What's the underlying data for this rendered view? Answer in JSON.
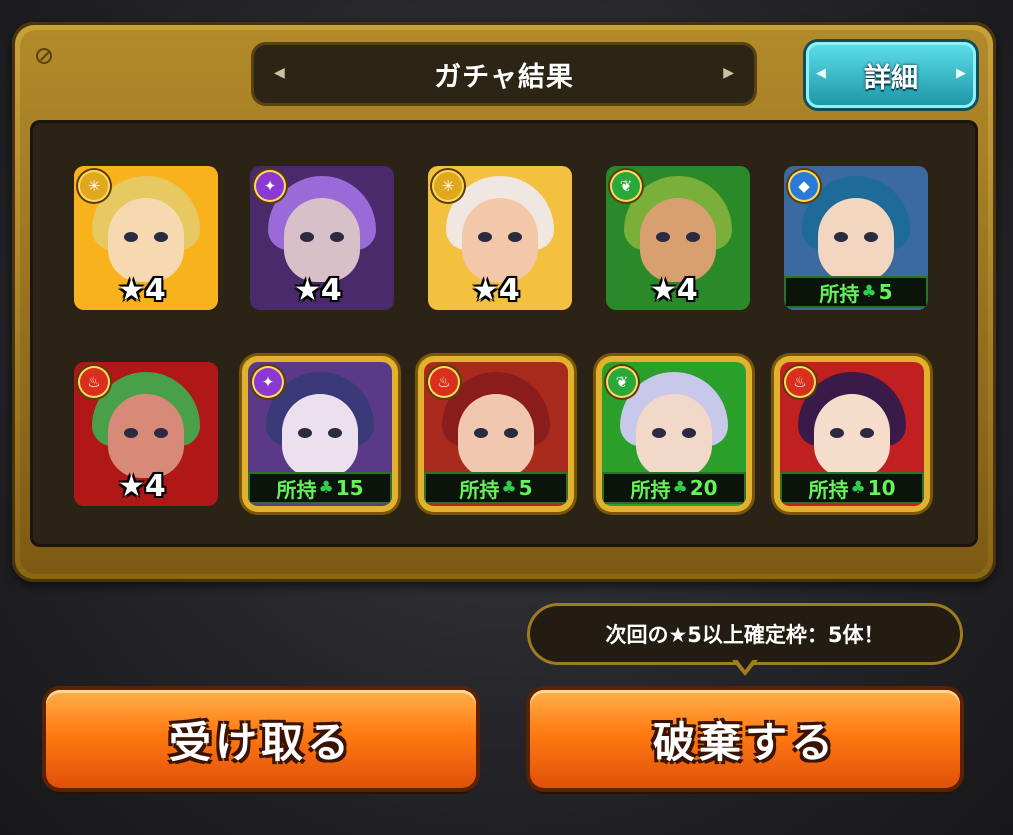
{
  "header": {
    "title": "ガチャ結果",
    "detail_label": "詳細"
  },
  "results_row1": [
    {
      "element_icon": "light-icon",
      "element_glyph": "✳",
      "element_color": "#e0a81c",
      "bg": "#f7b21c",
      "hair": "#e8c860",
      "face": "#f6d9b0",
      "star_label": "★4",
      "owned_label": null
    },
    {
      "element_icon": "dark-icon",
      "element_glyph": "✦",
      "element_color": "#8a3ad2",
      "bg": "#4a2a6a",
      "hair": "#9a6ad8",
      "face": "#d8c0c8",
      "star_label": "★4",
      "owned_label": null
    },
    {
      "element_icon": "light-icon",
      "element_glyph": "✳",
      "element_color": "#e0a81c",
      "bg": "#f4c040",
      "hair": "#f0e8e0",
      "face": "#f2c8a8",
      "star_label": "★4",
      "owned_label": null
    },
    {
      "element_icon": "wood-icon",
      "element_glyph": "❦",
      "element_color": "#2aa83a",
      "bg": "#2a8a2a",
      "hair": "#7ab03a",
      "face": "#d8a070",
      "star_label": "★4",
      "owned_label": null
    },
    {
      "element_icon": "water-icon",
      "element_glyph": "◆",
      "element_color": "#2a7ad8",
      "bg": "#3a6aa0",
      "hair": "#1e6a98",
      "face": "#f2d6c0",
      "star_label": null,
      "owned_prefix": "所持",
      "owned_count": "5"
    }
  ],
  "results_row2": [
    {
      "element_icon": "fire-icon",
      "element_glyph": "♨",
      "element_color": "#d8301c",
      "bg": "#b01818",
      "hair": "#4aa048",
      "face": "#d88a78",
      "star_label": "★4",
      "owned_label": null
    },
    {
      "element_icon": "dark-icon",
      "element_glyph": "✦",
      "element_color": "#8a3ad2",
      "bg": "#5a3a88",
      "hair": "#3a3a78",
      "face": "#ece0ee",
      "star_label": null,
      "owned_prefix": "所持",
      "owned_count": "15"
    },
    {
      "element_icon": "fire-icon",
      "element_glyph": "♨",
      "element_color": "#d8301c",
      "bg": "#a82a1c",
      "hair": "#8a1c1c",
      "face": "#f0c8b0",
      "star_label": null,
      "owned_prefix": "所持",
      "owned_count": "5"
    },
    {
      "element_icon": "wood-icon",
      "element_glyph": "❦",
      "element_color": "#2aa83a",
      "bg": "#2aa02a",
      "hair": "#c8c8ea",
      "face": "#f2d8c8",
      "star_label": null,
      "owned_prefix": "所持",
      "owned_count": "20"
    },
    {
      "element_icon": "fire-icon",
      "element_glyph": "♨",
      "element_color": "#d8301c",
      "bg": "#c02020",
      "hair": "#3a1a48",
      "face": "#f6dcca",
      "star_label": null,
      "owned_prefix": "所持",
      "owned_count": "10"
    }
  ],
  "tooltip": "次回の★5以上確定枠：5体！",
  "buttons": {
    "receive": "受け取る",
    "discard": "破棄する"
  }
}
